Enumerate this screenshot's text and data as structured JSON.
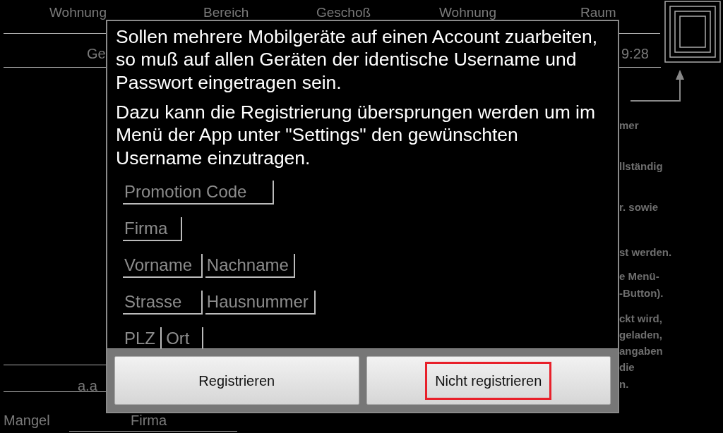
{
  "background": {
    "header_labels": [
      "Wohnung",
      "Bereich",
      "Geschoß",
      "Wohnung",
      "Raum"
    ],
    "row_texts": [
      {
        "text": "Ge",
        "kind": "left"
      },
      {
        "text": "9:28",
        "kind": "right"
      }
    ],
    "side_texts": [
      "mer",
      "llständig",
      "r. sowie",
      "st werden.",
      "e Menü-",
      "-Button).",
      "ckt wird,",
      "geladen,",
      "angaben",
      "die",
      "n."
    ],
    "bottom_texts": [
      {
        "text": "a.a",
        "kind": "value"
      },
      {
        "text": "Mangel",
        "kind": "label"
      },
      {
        "text": "Firma",
        "kind": "label"
      }
    ]
  },
  "dialog": {
    "paragraphs": [
      "Sollen mehrere Mobilgeräte auf einen Account zuarbeiten, so muß auf allen Geräten der identische Username und Passwort eingetragen sein.",
      "Dazu kann die Registrierung übersprungen werden um im Menü der App unter \"Settings\" den gewünschten Username einzutragen."
    ],
    "field_rows": [
      [
        {
          "placeholder": "Promotion Code"
        }
      ],
      [
        {
          "placeholder": "Firma"
        }
      ],
      [
        {
          "placeholder": "Vorname"
        },
        {
          "placeholder": "Nachname"
        }
      ],
      [
        {
          "placeholder": "Strasse"
        },
        {
          "placeholder": "Hausnummer"
        }
      ],
      [
        {
          "placeholder": "PLZ"
        },
        {
          "placeholder": "Ort"
        }
      ]
    ],
    "buttons": [
      {
        "label": "Registrieren",
        "highlighted": false
      },
      {
        "label": "Nicht registrieren",
        "highlighted": true
      }
    ]
  }
}
